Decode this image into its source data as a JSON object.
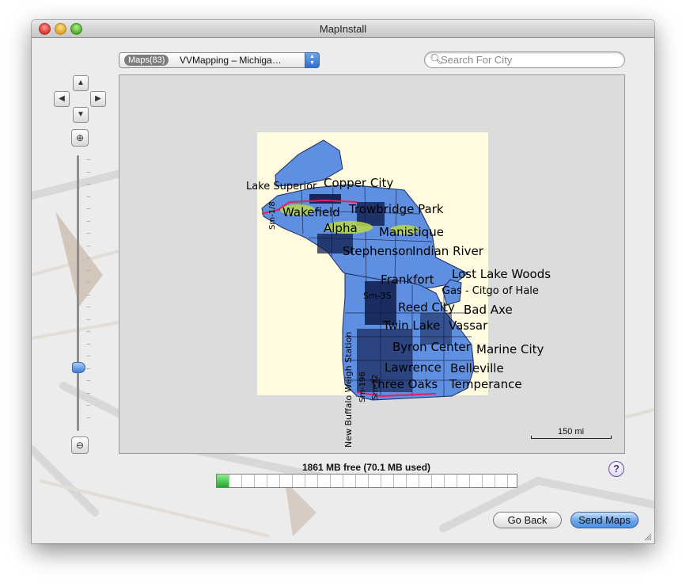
{
  "window": {
    "title": "MapInstall"
  },
  "toolbar": {
    "maps_badge": "Maps(83)",
    "map_selection": "VVMapping – Michiga…",
    "search_placeholder": "Search For City"
  },
  "map": {
    "background_color": "#fffbe0",
    "region_color": "#5f8fe0",
    "labels": [
      "Lake Superior",
      "Copper City",
      "Wakefield",
      "Trowbridge Park",
      "Alpha",
      "Manistique",
      "Stephenson",
      "Indian River",
      "Frankfort",
      "Lost Lake Woods",
      "Gas - Citgo of Hale",
      "Sm-35",
      "Reed City",
      "Bad Axe",
      "Twin Lake",
      "Vassar",
      "Byron Center",
      "Marine City",
      "Lawrence",
      "Belleville",
      "Three Oaks",
      "Temperance",
      "New Buffalo Weigh Station",
      "Sm-196",
      "Sm-1/8",
      "Sm-12"
    ],
    "scale_label": "150 mi"
  },
  "storage": {
    "label": "1861 MB free (70.1 MB used)",
    "used_fraction": 0.04
  },
  "buttons": {
    "help": "?",
    "back": "Go Back",
    "send": "Send Maps"
  }
}
